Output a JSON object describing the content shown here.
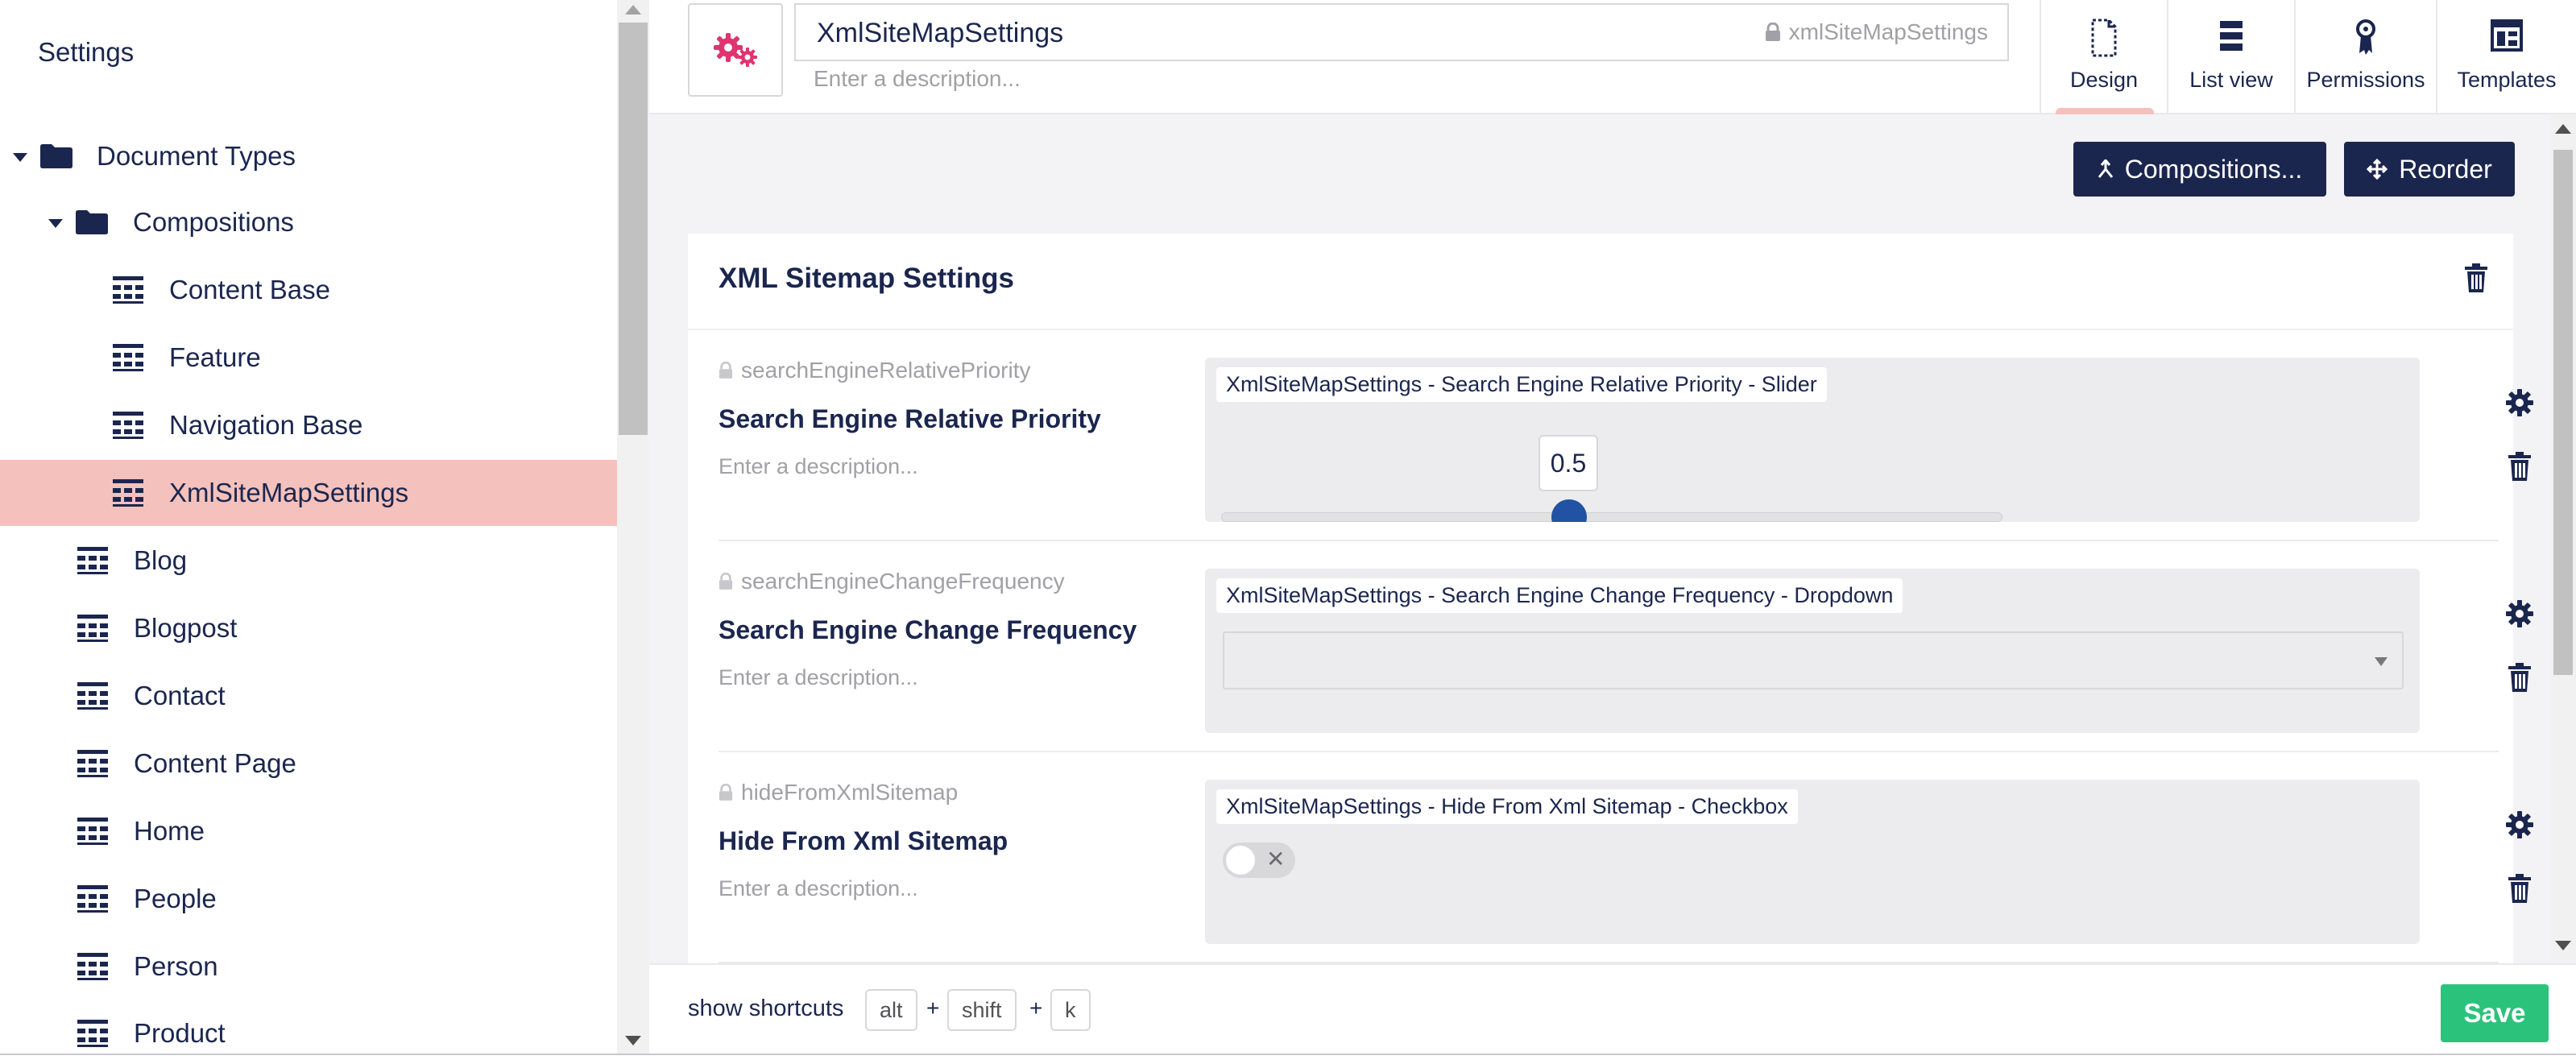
{
  "sidebar": {
    "title": "Settings",
    "items": [
      {
        "label": "Document Types"
      },
      {
        "label": "Compositions"
      },
      {
        "label": "Content Base"
      },
      {
        "label": "Feature"
      },
      {
        "label": "Navigation Base"
      },
      {
        "label": "XmlSiteMapSettings"
      },
      {
        "label": "Blog"
      },
      {
        "label": "Blogpost"
      },
      {
        "label": "Contact"
      },
      {
        "label": "Content Page"
      },
      {
        "label": "Home"
      },
      {
        "label": "People"
      },
      {
        "label": "Person"
      },
      {
        "label": "Product"
      }
    ]
  },
  "header": {
    "name_value": "XmlSiteMapSettings",
    "alias": "xmlSiteMapSettings",
    "description_placeholder": "Enter a description...",
    "tabs": [
      {
        "label": "Design"
      },
      {
        "label": "List view"
      },
      {
        "label": "Permissions"
      },
      {
        "label": "Templates"
      }
    ]
  },
  "actions": {
    "compositions_label": "Compositions...",
    "reorder_label": "Reorder"
  },
  "group": {
    "title": "XML Sitemap Settings",
    "properties": [
      {
        "alias": "searchEngineRelativePriority",
        "name": "Search Engine Relative Priority",
        "description": "Enter a description...",
        "editor_label": "XmlSiteMapSettings - Search Engine Relative Priority - Slider",
        "slider_value": "0.5"
      },
      {
        "alias": "searchEngineChangeFrequency",
        "name": "Search Engine Change Frequency",
        "description": "Enter a description...",
        "editor_label": "XmlSiteMapSettings - Search Engine Change Frequency - Dropdown"
      },
      {
        "alias": "hideFromXmlSitemap",
        "name": "Hide From Xml Sitemap",
        "description": "Enter a description...",
        "editor_label": "XmlSiteMapSettings - Hide From Xml Sitemap - Checkbox"
      }
    ]
  },
  "footer": {
    "shortcuts_label": "show shortcuts",
    "keys": [
      "alt",
      "shift",
      "k"
    ],
    "plus": "+",
    "save_label": "Save"
  },
  "colors": {
    "brand_dark": "#1b264f",
    "selected_bg": "#f5c1bc",
    "save_green": "#2bc37c",
    "icon_pink": "#e0336f",
    "slider_blue": "#2152a3"
  },
  "icons": {
    "doc_type_icon": "gears-icon",
    "folder": "folder-icon",
    "document_type": "grid-icon",
    "lock": "lock-icon",
    "settings": "gear-icon",
    "delete": "trash-icon"
  }
}
